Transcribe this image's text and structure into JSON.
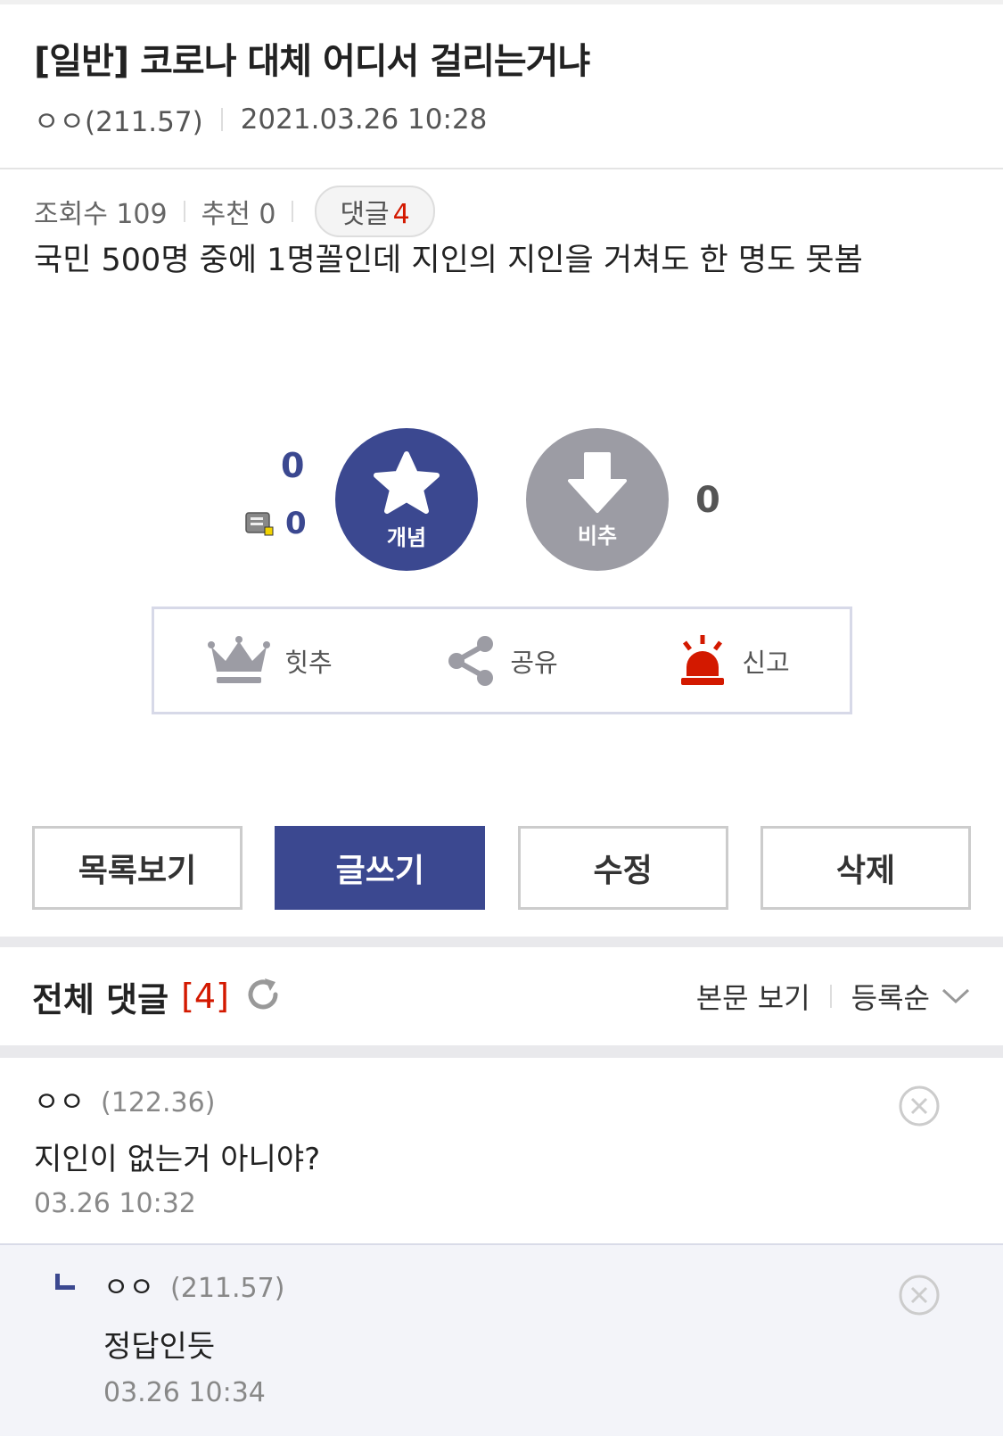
{
  "post": {
    "title": "[일반] 코로나 대체 어디서 걸리는거냐",
    "author": "ㅇㅇ(211.57)",
    "datetime": "2021.03.26 10:28",
    "views": "조회수 109",
    "recommend": "추천 0",
    "comment_label": "댓글",
    "comment_count": "4",
    "body": "국민 500명 중에 1명꼴인데 지인의 지인을 거쳐도 한 명도 못봄"
  },
  "vote": {
    "up_count": "0",
    "fix_count": "0",
    "up_label": "개념",
    "down_label": "비추",
    "down_count": "0"
  },
  "actions": {
    "hit": "힛추",
    "share": "공유",
    "report": "신고"
  },
  "buttons": {
    "list": "목록보기",
    "write": "글쓰기",
    "edit": "수정",
    "delete": "삭제"
  },
  "comments_header": {
    "title": "전체 댓글",
    "count": "[4]",
    "view_body": "본문 보기",
    "sort": "등록순"
  },
  "comments": [
    {
      "name": "ㅇㅇ",
      "ip": "(122.36)",
      "text": "지인이 없는거 아니야?",
      "date": "03.26 10:32"
    },
    {
      "name": "ㅇㅇ",
      "ip": "(211.57)",
      "text": "정답인듯",
      "date": "03.26 10:34"
    }
  ],
  "colors": {
    "accent": "#3b4890",
    "red": "#d31900",
    "downvote": "#9c9ca4"
  }
}
